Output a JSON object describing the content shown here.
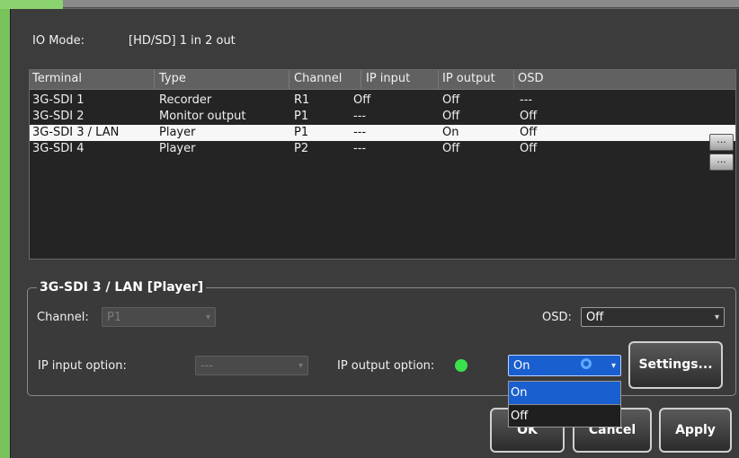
{
  "io_mode": {
    "label": "IO Mode:",
    "value": "[HD/SD] 1 in 2 out"
  },
  "table": {
    "headers": [
      "Terminal",
      "Type",
      "Channel",
      "IP input",
      "IP output",
      "OSD"
    ],
    "rows": [
      {
        "terminal": "3G-SDI 1",
        "type": "Recorder",
        "channel": "R1",
        "ip_input": "Off",
        "ip_output": "Off",
        "osd": "---"
      },
      {
        "terminal": "3G-SDI 2",
        "type": "Monitor output",
        "channel": "P1",
        "ip_input": "---",
        "ip_output": "Off",
        "osd": "Off"
      },
      {
        "terminal": "3G-SDI 3 / LAN",
        "type": "Player",
        "channel": "P1",
        "ip_input": "---",
        "ip_output": "On",
        "osd": "Off"
      },
      {
        "terminal": "3G-SDI 4",
        "type": "Player",
        "channel": "P2",
        "ip_input": "---",
        "ip_output": "Off",
        "osd": "Off"
      }
    ],
    "row_button_label": "...",
    "selected_row": 3
  },
  "detail": {
    "title": "3G-SDI 3 / LAN [Player]",
    "channel_label": "Channel:",
    "channel_value": "P1",
    "osd_label": "OSD:",
    "osd_value": "Off",
    "ip_input_label": "IP input option:",
    "ip_input_value": "---",
    "ip_output_label": "IP output option:",
    "ip_output_status_color": "#3be04d",
    "ip_output_value": "On",
    "ip_output_options": [
      "On",
      "Off"
    ],
    "settings_label": "Settings..."
  },
  "buttons": {
    "ok": "OK",
    "cancel": "Cancel",
    "apply": "Apply"
  },
  "colors": {
    "accent_blue": "#1a5fcf",
    "frame_green": "#79c25c",
    "selection_bg": "#f7f7f7"
  }
}
